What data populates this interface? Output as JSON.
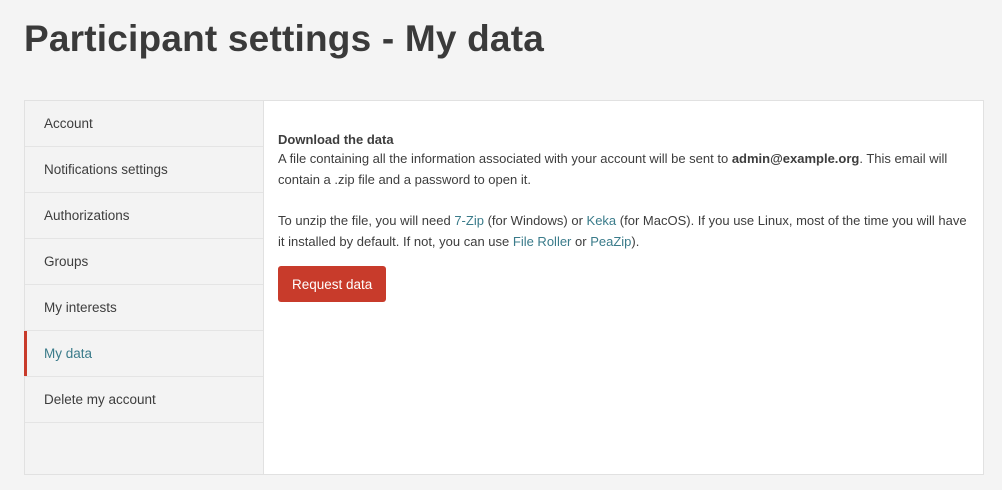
{
  "page": {
    "title": "Participant settings - My data"
  },
  "sidebar": {
    "items": [
      {
        "label": "Account",
        "active": false
      },
      {
        "label": "Notifications settings",
        "active": false
      },
      {
        "label": "Authorizations",
        "active": false
      },
      {
        "label": "Groups",
        "active": false
      },
      {
        "label": "My interests",
        "active": false
      },
      {
        "label": "My data",
        "active": true
      },
      {
        "label": "Delete my account",
        "active": false
      }
    ]
  },
  "main": {
    "heading": "Download the data",
    "para1": {
      "before_email": "A file containing all the information associated with your account will be sent to ",
      "email": "admin@example.org",
      "after_email": ". This email will contain a .zip file and a password to open it."
    },
    "para2": {
      "t1": "To unzip the file, you will need ",
      "link_7zip": "7-Zip",
      "t2": " (for Windows) or ",
      "link_keka": "Keka",
      "t3": " (for MacOS). If you use Linux, most of the time you will have it installed by default. If not, you can use ",
      "link_fileroller": "File Roller",
      "t4": " or ",
      "link_peazip": "PeaZip",
      "t5": ")."
    },
    "button_label": "Request data"
  },
  "colors": {
    "accent": "#c83b2b",
    "link": "#3a7b8a",
    "background": "#f4f4f4"
  }
}
